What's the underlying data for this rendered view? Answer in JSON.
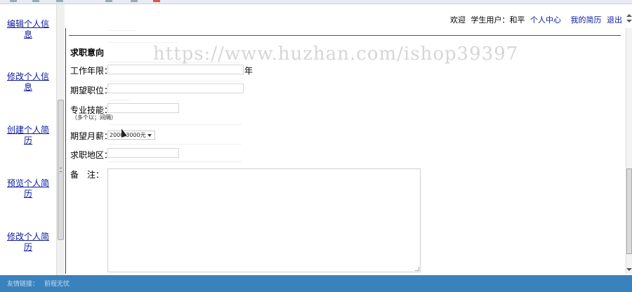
{
  "header": {
    "welcome": "欢迎",
    "user_role": "学生用户：",
    "user_name": "和平",
    "nav": {
      "personal_center": "个人中心",
      "my_resume": "我的简历",
      "logout": "退出"
    }
  },
  "sidebar": {
    "items": [
      {
        "label_line1": "编辑个人信",
        "label_line2": "息"
      },
      {
        "label_line1": "修改个人信",
        "label_line2": "息"
      },
      {
        "label_line1": "创建个人简",
        "label_line2": "历"
      },
      {
        "label_line1": "预览个人简",
        "label_line2": "历"
      },
      {
        "label_line1": "修改个人简",
        "label_line2": "历"
      }
    ]
  },
  "form": {
    "section_title": "求职意向",
    "work_years_label": "工作年限：",
    "work_years_value": "",
    "work_years_unit": "年",
    "position_label": "期望职位：",
    "position_value": "",
    "skills_label": "专业技能：",
    "skills_value": "",
    "skills_hint": "（多个以；间隔）",
    "salary_label": "期望月薪：",
    "salary_selected": "2000-3000元",
    "location_label": "求职地区：",
    "location_value": "",
    "remarks_label": "备　注：",
    "remarks_value": ""
  },
  "watermark": "https://www.huzhan.com/ishop39397",
  "footer": {
    "links_label": "友情链接：",
    "link_1": "前程无忧"
  },
  "icons": [
    "scroll-up-icon",
    "scroll-down-icon",
    "select-caret-icon",
    "mouse-cursor-icon",
    "resize-grip-icon"
  ]
}
